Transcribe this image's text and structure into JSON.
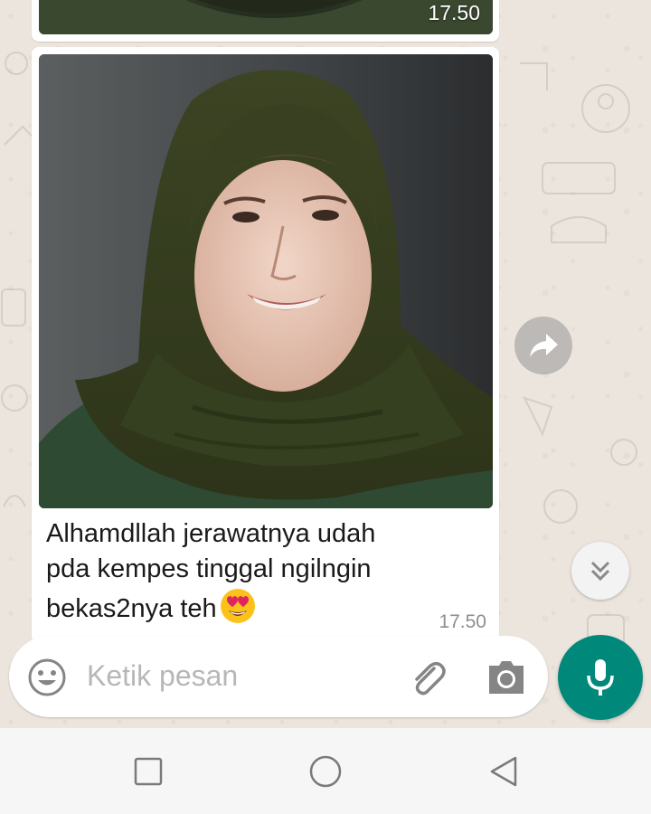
{
  "previous_message": {
    "time": "17.50"
  },
  "message": {
    "caption_line1": "Alhamdllah jerawatnya udah",
    "caption_line2": "pda kempes tinggal ngilngin",
    "caption_line3": "bekas2nya teh",
    "emoji": "smiling-face-with-heart-eyes",
    "time": "17.50"
  },
  "composer": {
    "placeholder": "Ketik pesan",
    "emoji_icon": "smiley-icon",
    "attach_icon": "paperclip-icon",
    "camera_icon": "camera-icon",
    "mic_icon": "mic-icon"
  },
  "navbar": {
    "recents_icon": "square-icon",
    "home_icon": "circle-icon",
    "back_icon": "triangle-back-icon"
  },
  "colors": {
    "accent": "#00897b",
    "wallpaper": "#ece5dd",
    "bubble": "#ffffff"
  }
}
